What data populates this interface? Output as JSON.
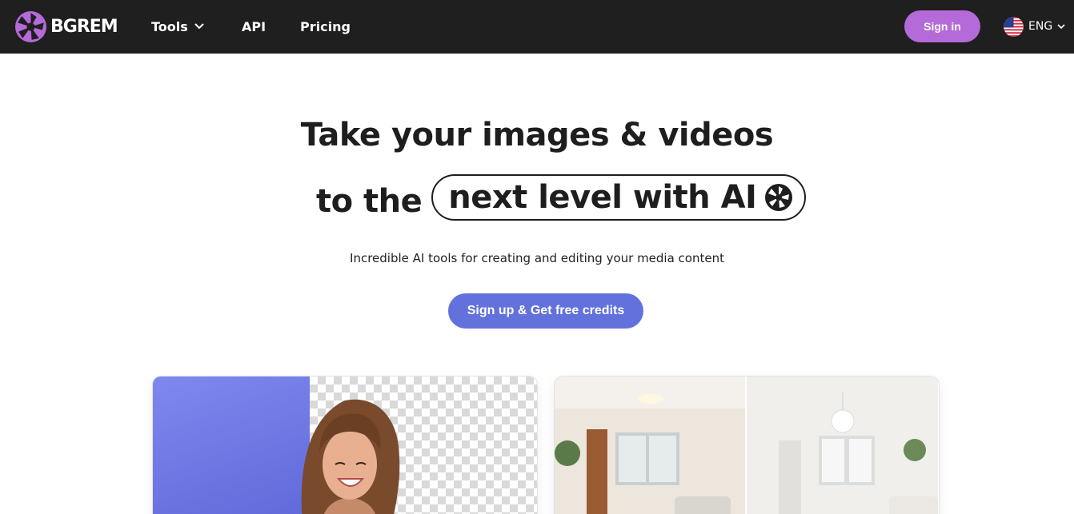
{
  "brand": {
    "name": "BGREM",
    "accent": "#b46ad9"
  },
  "nav": {
    "items": [
      {
        "label": "Tools",
        "has_dropdown": true
      },
      {
        "label": "API"
      },
      {
        "label": "Pricing"
      }
    ],
    "signin_label": "Sign in",
    "language": {
      "code": "ENG",
      "flag_icon": "us-flag-icon"
    }
  },
  "hero": {
    "line1": "Take your images & videos",
    "line2_lead": "to the",
    "line2_pill": "next level with AI",
    "subtitle": "Incredible AI tools for creating and editing your media content",
    "cta_label": "Sign up & Get free credits",
    "cta_color": "#6371dc"
  },
  "cards": [
    {
      "name": "background-remover-preview",
      "accent": "#6d77e2"
    },
    {
      "name": "room-redesign-preview"
    }
  ]
}
